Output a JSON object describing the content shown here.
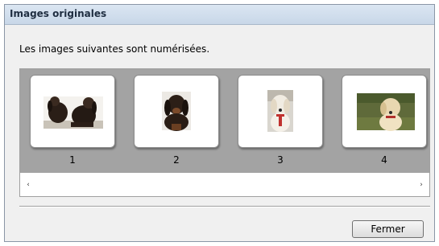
{
  "window": {
    "title": "Images originales"
  },
  "message": "Les images suivantes sont numérisées.",
  "thumbnails": [
    {
      "label": "1",
      "icon": "photo-two-black-dogs-icon"
    },
    {
      "label": "2",
      "icon": "photo-black-dog-portrait-icon"
    },
    {
      "label": "3",
      "icon": "photo-white-dog-icon"
    },
    {
      "label": "4",
      "icon": "photo-yellow-dog-on-grass-icon"
    }
  ],
  "scrollbar": {
    "left_arrow": "‹",
    "right_arrow": "›"
  },
  "buttons": {
    "close": "Fermer"
  }
}
